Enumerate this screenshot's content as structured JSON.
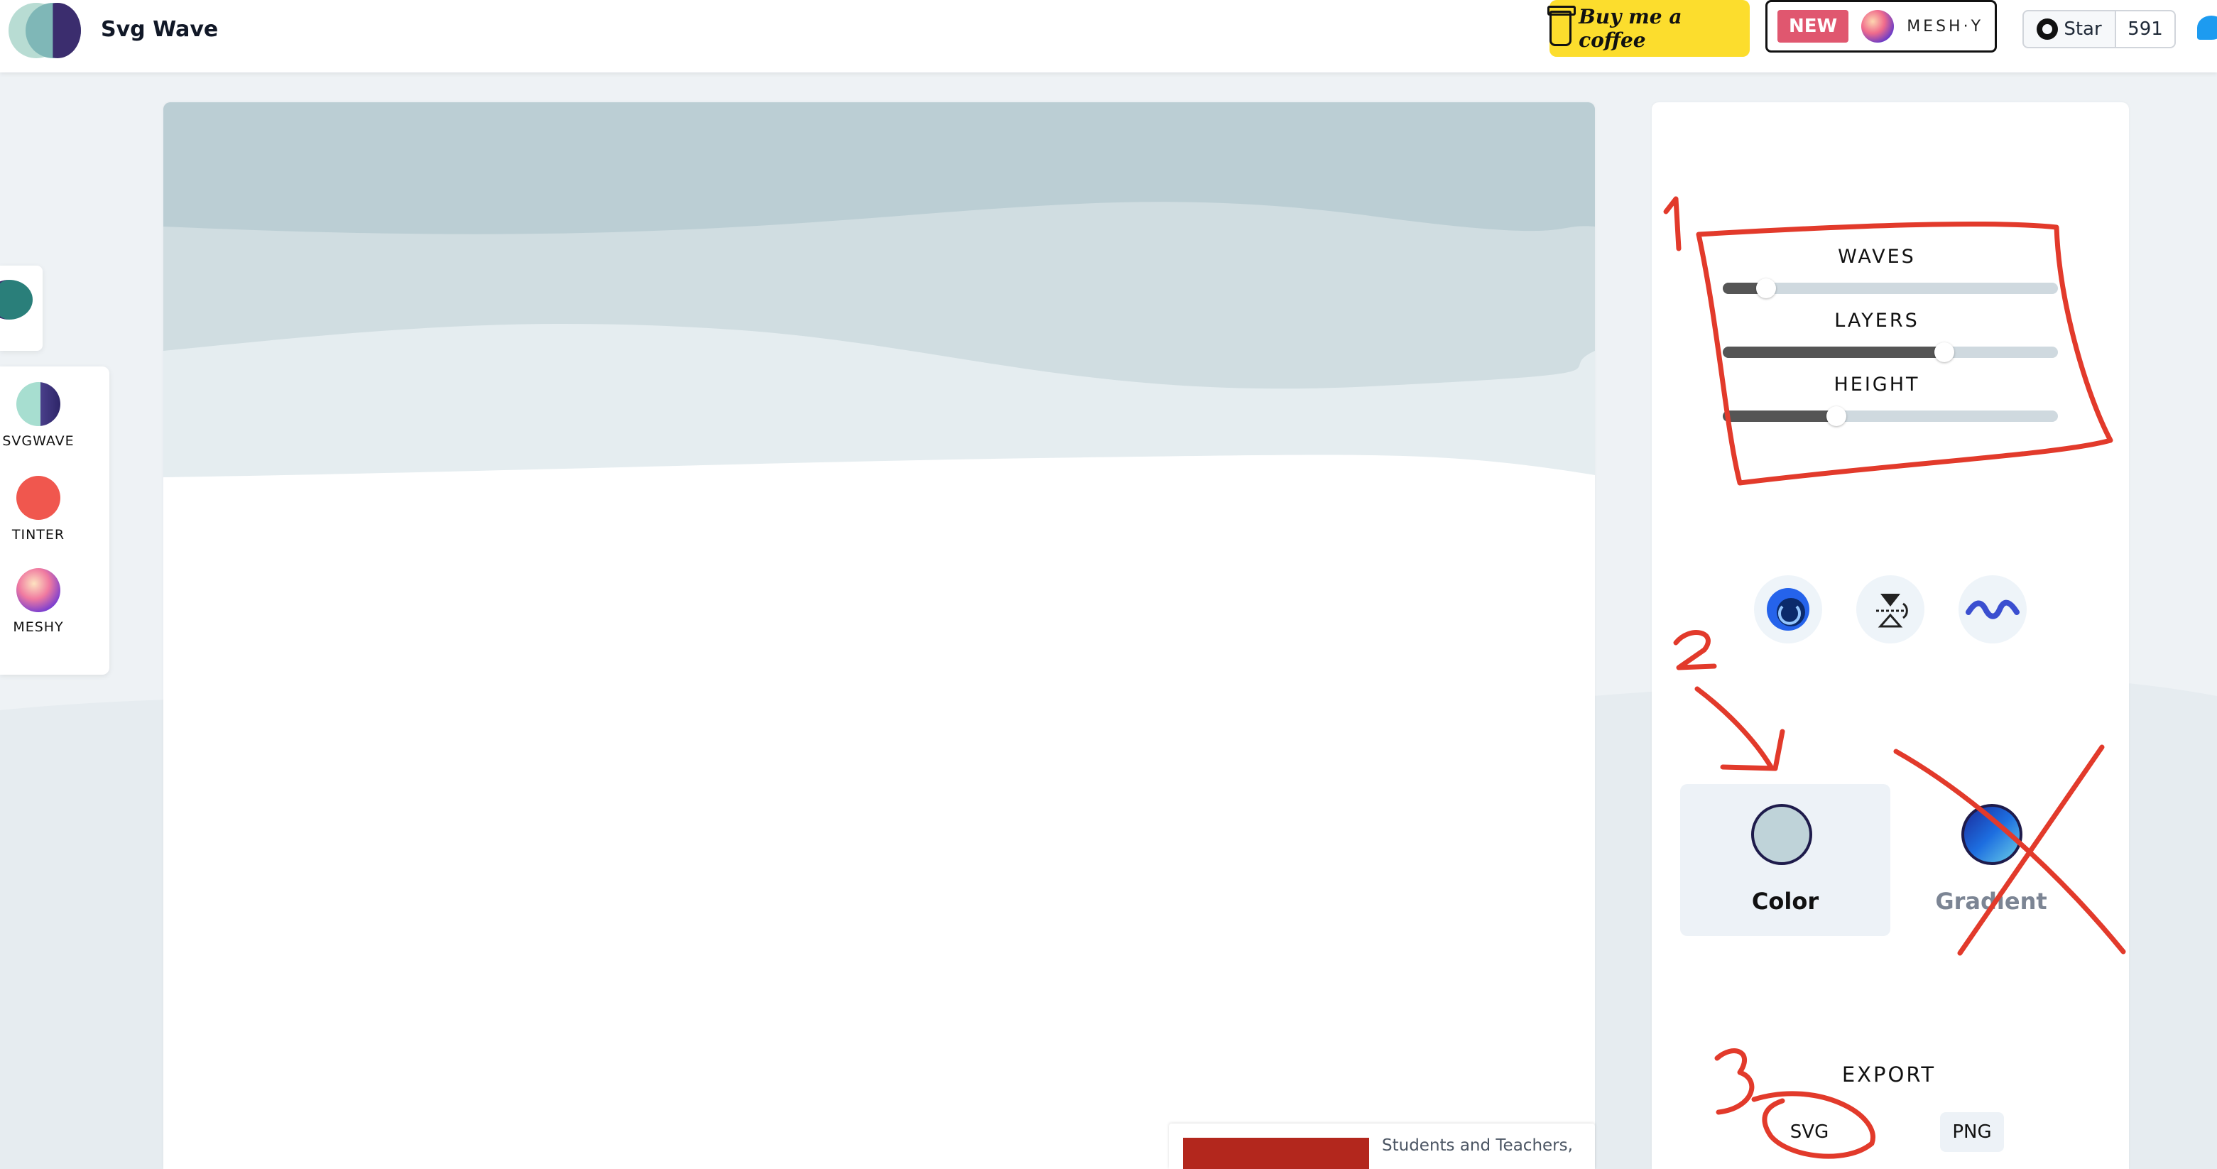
{
  "header": {
    "app_title": "Svg Wave",
    "coffee_label": "Buy me a coffee",
    "new_badge": "NEW",
    "meshy_label": "MESH·Y",
    "star_label": "Star",
    "star_count": "591"
  },
  "sidebar": {
    "apps": [
      {
        "label": "SVGWAVE",
        "icon": "svgwave-logo-icon"
      },
      {
        "label": "TINTER",
        "icon": "tinter-logo-icon"
      },
      {
        "label": "MESHY",
        "icon": "meshy-logo-icon"
      }
    ]
  },
  "canvas": {
    "wave_colors": [
      "#bbced4",
      "#d0dde1",
      "#e5edf0"
    ],
    "promo_text": "Students and Teachers,"
  },
  "controls": {
    "sliders": [
      {
        "label": "WAVES",
        "value": 0.13
      },
      {
        "label": "LAYERS",
        "value": 0.66
      },
      {
        "label": "HEIGHT",
        "value": 0.34
      }
    ],
    "actions": [
      "shuffle-icon",
      "invert-icon",
      "wave-icon"
    ],
    "fill_modes": {
      "color": "Color",
      "gradient": "Gradient",
      "color_value": "#bfd3d9"
    },
    "export_label": "EXPORT",
    "export_svg": "SVG",
    "export_png": "PNG"
  },
  "annotations": {
    "marks": [
      "1",
      "2",
      "3"
    ],
    "color": "#e23a2b"
  }
}
